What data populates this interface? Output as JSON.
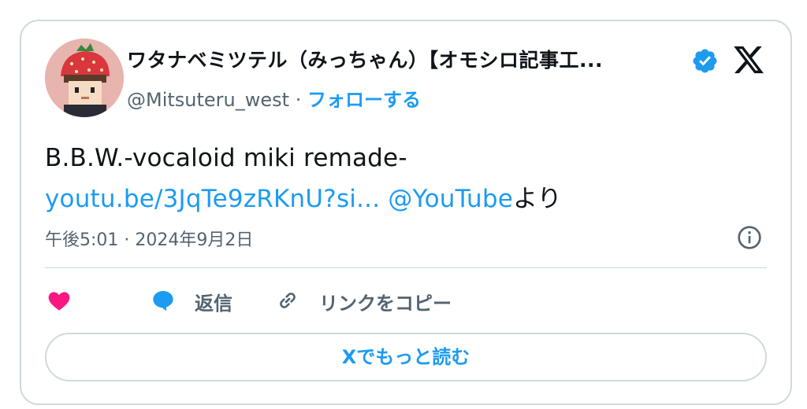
{
  "tweet": {
    "author_name": "ワタナベミツテル（みっちゃん）【オモシロ記事工...",
    "handle": "@Mitsuteru_west",
    "separator": "·",
    "follow_label": "フォローする",
    "text_line1": "B.B.W.-vocaloid miki remade-",
    "link_url": "youtu.be/3JqTe9zRKnU?si...",
    "link_mention": "@YouTube",
    "text_suffix": "より",
    "timestamp": "午後5:01 · 2024年9月2日"
  },
  "actions": {
    "reply_label": "返信",
    "copy_link_label": "リンクをコピー"
  },
  "read_more_label": "Xでもっと読む",
  "colors": {
    "accent": "#1d9bf0",
    "like": "#f91880",
    "muted": "#536471",
    "border": "#cfd9de"
  },
  "icons": [
    "avatar",
    "verified-badge-icon",
    "x-logo-icon",
    "info-icon",
    "heart-icon",
    "reply-bubble-icon",
    "link-icon"
  ]
}
